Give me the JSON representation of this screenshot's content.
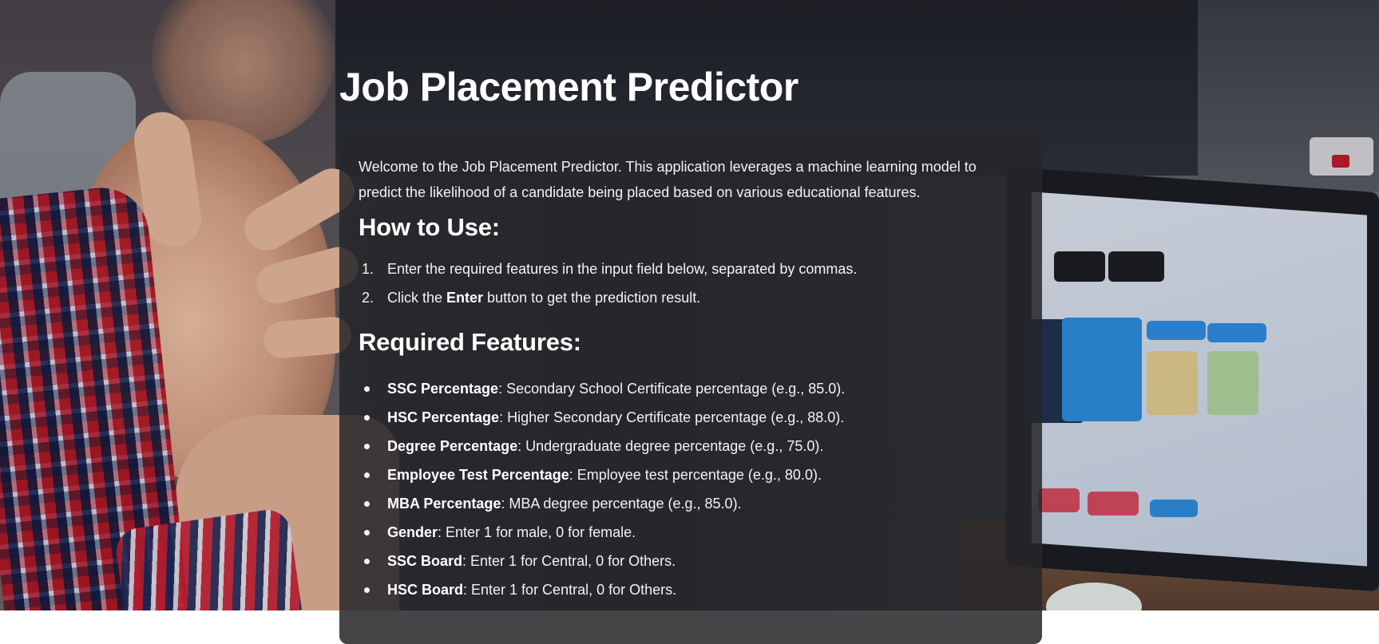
{
  "header": {
    "title": "Job Placement Predictor"
  },
  "intro": {
    "text": "Welcome to the Job Placement Predictor. This application leverages a machine learning model to predict the likelihood of a candidate being placed based on various educational features."
  },
  "how_to_use": {
    "heading": "How to Use:",
    "steps": [
      {
        "num": "1.",
        "pre": "Enter the required features in the input field below, separated by commas.",
        "bold": "",
        "post": ""
      },
      {
        "num": "2.",
        "pre": "Click the ",
        "bold": "Enter",
        "post": " button to get the prediction result."
      }
    ]
  },
  "required_features": {
    "heading": "Required Features:",
    "items": [
      {
        "name": "SSC Percentage",
        "desc": ": Secondary School Certificate percentage (e.g., 85.0)."
      },
      {
        "name": "HSC Percentage",
        "desc": ": Higher Secondary Certificate percentage (e.g., 88.0)."
      },
      {
        "name": "Degree Percentage",
        "desc": ": Undergraduate degree percentage (e.g., 75.0)."
      },
      {
        "name": "Employee Test Percentage",
        "desc": ": Employee test percentage (e.g., 80.0)."
      },
      {
        "name": "MBA Percentage",
        "desc": ": MBA degree percentage (e.g., 85.0)."
      },
      {
        "name": "Gender",
        "desc": ": Enter 1 for male, 0 for female."
      },
      {
        "name": "SSC Board",
        "desc": ": Enter 1 for Central, 0 for Others."
      },
      {
        "name": "HSC Board",
        "desc": ": Enter 1 for Central, 0 for Others."
      }
    ]
  }
}
